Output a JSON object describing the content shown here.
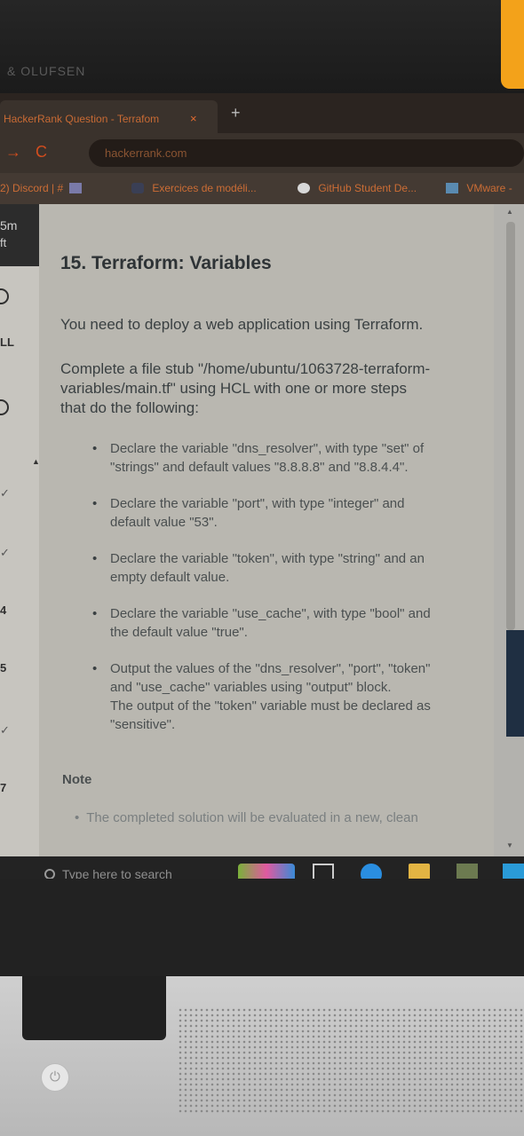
{
  "monitor": {
    "brand": "& OLUFSEN"
  },
  "browser": {
    "tab": {
      "title": "HackerRank Question - Terrafom",
      "close": "×"
    },
    "new_tab": "+",
    "nav": {
      "forward": "→",
      "reload": "C"
    },
    "url": "hackerrank.com",
    "bookmarks": [
      "2) Discord | #",
      "Exercices de modéli...",
      "GitHub Student De...",
      "VMware -"
    ]
  },
  "sidebar": {
    "timer_value": "5m",
    "timer_unit": "ft",
    "labels": [
      "LL",
      "4",
      "5",
      "7"
    ]
  },
  "question": {
    "title": "15. Terraform: Variables",
    "intro": "You need to deploy a web application using Terraform.",
    "task_lines": [
      "Complete a file stub \"/home/ubuntu/1063728-terraform-",
      "variables/main.tf\" using HCL with one or more steps",
      "that do the following:"
    ],
    "steps": [
      [
        "Declare the variable \"dns_resolver\", with type \"set\" of",
        "\"strings\" and default values \"8.8.8.8\" and \"8.8.4.4\"."
      ],
      [
        "Declare the variable \"port\", with type \"integer\" and",
        "default value \"53\"."
      ],
      [
        "Declare the variable \"token\", with type \"string\" and an",
        "empty default value."
      ],
      [
        "Declare the variable \"use_cache\", with type \"bool\" and",
        "the default value \"true\"."
      ],
      [
        "Output the values of the \"dns_resolver\", \"port\", \"token\"",
        "and \"use_cache\" variables using \"output\" block.",
        "The output of the \"token\" variable must be declared as",
        "\"sensitive\"."
      ]
    ],
    "note_heading": "Note",
    "note_items": [
      "The completed solution will be evaluated in a new, clean"
    ]
  },
  "taskbar": {
    "search_placeholder": "Type here to search"
  },
  "colors": {
    "accent": "#d24d1e",
    "page_bg": "#b9b7b0",
    "text": "#3a4042"
  }
}
